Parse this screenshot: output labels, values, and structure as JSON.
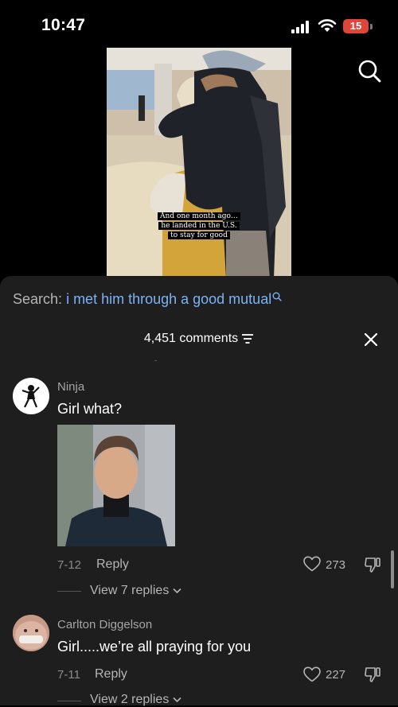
{
  "status_bar": {
    "time": "10:47",
    "battery": "15",
    "battery_color": "#e0443a"
  },
  "video": {
    "caption_lines": [
      "And one month ago…",
      "he landed in the U.S.",
      "to stay for good"
    ]
  },
  "search": {
    "label": "Search:",
    "query": "i met him through a good mutual",
    "query_color": "#7cb3f5"
  },
  "comments_header": {
    "count": "4,451 comments"
  },
  "comments": [
    {
      "author": "Ninja",
      "text": "Girl what?",
      "date": "7-12",
      "reply_label": "Reply",
      "likes": "273",
      "view_replies": "View 7 replies"
    },
    {
      "author": "Carlton Diggelson",
      "text": "Girl.....we’re all praying for you",
      "date": "7-11",
      "reply_label": "Reply",
      "likes": "227",
      "view_replies": "View 2 replies"
    }
  ],
  "icons": [
    "signal-icon",
    "wifi-icon",
    "battery-icon",
    "search-icon",
    "filter-icon",
    "close-icon",
    "heart-icon",
    "dislike-icon",
    "chevron-down-icon"
  ]
}
